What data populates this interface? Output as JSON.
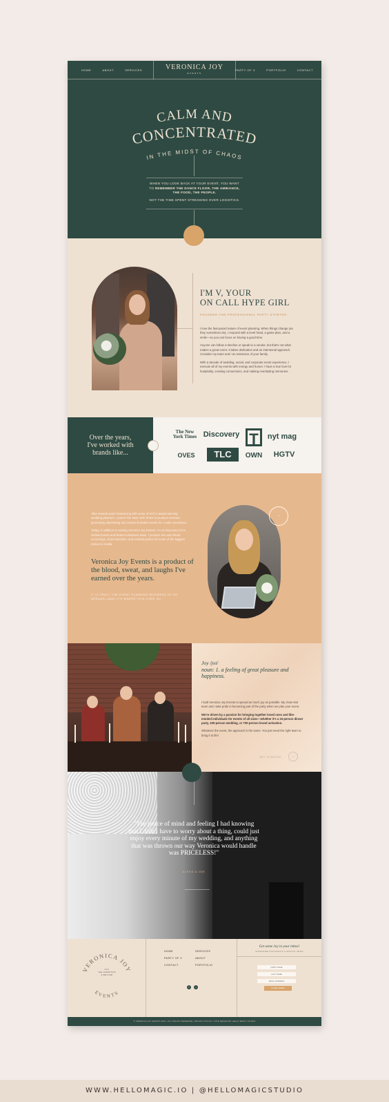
{
  "nav": {
    "left": [
      "HOME",
      "ABOUT",
      "SERVICES"
    ],
    "logo": "VERONICA JOY",
    "logo_sub": "EVENTS",
    "right": [
      "PARTY OF V",
      "PORTFOLIO",
      "CONTACT"
    ]
  },
  "hero": {
    "line1": "CALM AND",
    "line2": "CONCENTRATED",
    "line3": "IN THE MIDST OF CHAOS",
    "text1": "WHEN YOU LOOK BACK AT YOUR EVENT, YOU WANT",
    "text2_pre": "TO ",
    "text2_bold": "REMEMBER THE DANCE FLOOR, THE AMBIANCE,",
    "text3": "THE FOOD, THE PEOPLE.",
    "text4": "NOT THE TIME SPENT STRESSING OVER LOGISTICS."
  },
  "about": {
    "title1": "I'M V, YOUR",
    "title2": "ON CALL HYPE GIRL",
    "subtitle": "FOUNDER AND PROFESSIONAL PARTY STARTER.",
    "p1": "I love the fast-paced nature of event planning. When things change (as they sometimes do), I respond with a level head, a game plan, and a smile—so you can focus on having a good time.",
    "p2": "Anyone can follow a timeline or speak to a vendor, but that's not what makes a great event. It takes dedication and an intentional approach. Consider my team and I an extension of your family.",
    "p3": "With a decade of wedding, social, and corporate event experience, I execute all of my events with energy and humor. I have a true love for hospitality, creating connections, and making everlasting memories."
  },
  "brands": {
    "heading1": "Over the years,",
    "heading2": "I've worked with",
    "heading3": "brands like...",
    "logos": [
      "The New York Times",
      "Discovery",
      "T",
      "nyt mag",
      "OVES",
      "TLC",
      "OWN",
      "HGTV"
    ]
  },
  "story": {
    "p1": "After several years freelancing with some of NYC's award-winning wedding planners, I joined The New York Times to produce revenue-generating advertising and custom branded events for c-suite executives.",
    "p2": "Today, in addition to owning Veronica Joy Events, I'm on Discovery Inc's Global Events and Brand Activations team. I produce live and virtual screenings, show launches, and cocktail parties for some of the biggest names in media.",
    "quote": "Veronica Joy Events is a product of the blood, sweat, and laughs I've earned over the years.",
    "caption": "IT IS TRULY THE EVENT PLANNING BUSINESS OF MY DREAMS—AND IT'S WHERE THIS CORE IN!"
  },
  "team": {
    "word": "Joy /joi/",
    "noun": "noun: 1. a feeling of great pleasure and happiness.",
    "p1": "I built Veronica Joy Events to spread as much joy as possible. My close-knit team and I take pride in becoming part of the party when we plan your event.",
    "p2_bold": "We're driven by a passion for bringing together loved ones and like-minded individuals for events of all sizes—whether it's a 15-person dinner party, 200-person wedding, or 700-person brand activation.",
    "p3": "Whatever the event, the approach is the same. You just need the right team to bring it to life!",
    "link": "GET STARTED",
    "arrow": "→"
  },
  "testimonial": {
    "quote": "\"The peace of mind and feeling I had knowing that I didn't have to worry about a thing, could just enjoy every minute of my wedding, and anything that was thrown our way Veronica would handle was PRICELESS!\"",
    "author": "ALEXA & JOE"
  },
  "footer": {
    "logo_top": "VERONICA JOY",
    "logo_bottom": "EVENTS",
    "tag1": "NYC",
    "tag2": "THE HAMPTONS",
    "tag3": "& BEYOND",
    "nav": [
      "HOME",
      "SERVICES",
      "PARTY OF V",
      "ABOUT",
      "CONTACT",
      "PORTFOLIO"
    ],
    "signup_title": "Get some Joy in your inbox!",
    "signup_sub": "SUBSCRIBE FOR EVENTS & SPECIAL NEWS",
    "first_name": "FIRST NAME",
    "last_name": "LAST NAME",
    "email": "EMAIL ADDRESS",
    "button": "SUBSCRIBE",
    "copyright": "© VERONICA JOY EVENTS 2021  |  ALL RIGHTS RESERVED  |  PRIVACY POLICY  |  SITE DESIGN BY HELLO MAGIC STUDIO"
  },
  "bottom_bar": "WWW.HELLOMAGIC.IO  |  @HELLOMAGICSTUDIO",
  "colors": {
    "forest": "#2e4a43",
    "cream": "#efe1d2",
    "tan": "#e6b88e",
    "gold": "#d8a46a"
  }
}
